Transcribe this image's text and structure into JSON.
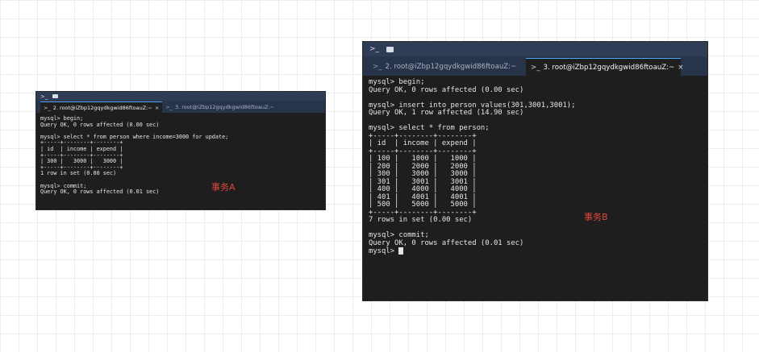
{
  "terminal_a": {
    "titlebar_icon": ">_",
    "tabs": [
      {
        "label": "2. root@iZbp12gqydkgwid86ftoauZ:~",
        "active": true,
        "close": "×"
      },
      {
        "label": "3. root@iZbp12gqydkgwid86ftoauZ:~",
        "active": false
      }
    ],
    "output": "mysql> begin;\nQuery OK, 0 rows affected (0.00 sec)\n\nmysql> select * from person where income=3000 for update;\n+-----+--------+--------+\n| id  | income | expend |\n+-----+--------+--------+\n| 300 |   3000 |   3000 |\n+-----+--------+--------+\n1 row in set (0.00 sec)\n\nmysql> commit;\nQuery OK, 0 rows affected (0.01 sec)",
    "annotation": "事务A"
  },
  "terminal_b": {
    "titlebar_icon": ">_",
    "tabs": [
      {
        "label": "2. root@iZbp12gqydkgwid86ftoauZ:~",
        "active": false
      },
      {
        "label": "3. root@iZbp12gqydkgwid86ftoauZ:~",
        "active": true,
        "close": "×"
      }
    ],
    "output": "mysql> begin;\nQuery OK, 0 rows affected (0.00 sec)\n\nmysql> insert into person values(301,3001,3001);\nQuery OK, 1 row affected (14.90 sec)\n\nmysql> select * from person;\n+-----+--------+--------+\n| id  | income | expend |\n+-----+--------+--------+\n| 100 |   1000 |   1000 |\n| 200 |   2000 |   2000 |\n| 300 |   3000 |   3000 |\n| 301 |   3001 |   3001 |\n| 400 |   4000 |   4000 |\n| 401 |   4001 |   4001 |\n| 500 |   5000 |   5000 |\n+-----+--------+--------+\n7 rows in set (0.00 sec)\n\nmysql> commit;\nQuery OK, 0 rows affected (0.01 sec)\n",
    "prompt": "mysql> ",
    "annotation": "事务B"
  },
  "colors": {
    "terminal_bg": "#1e1e1e",
    "titlebar_bg": "#2e3d55",
    "active_tab_border": "#4da3ff",
    "annotation": "#e0483a"
  }
}
